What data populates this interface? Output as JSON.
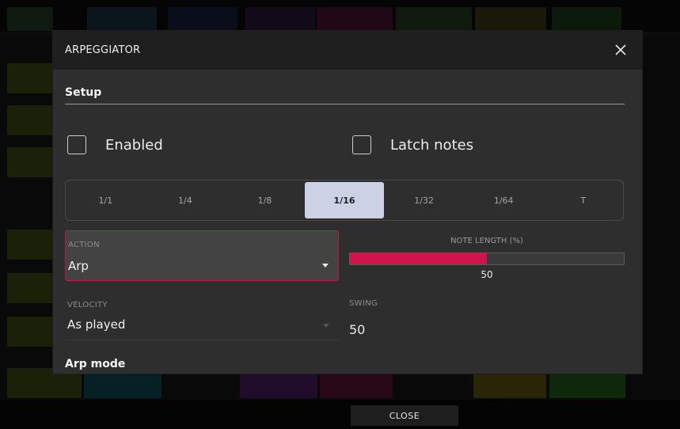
{
  "dialog": {
    "title": "ARPEGGIATOR",
    "setup_title": "Setup",
    "enabled_label": "Enabled",
    "latch_label": "Latch notes",
    "divisions": [
      "1/1",
      "1/4",
      "1/8",
      "1/16",
      "1/32",
      "1/64",
      "T"
    ],
    "active_division": "1/16",
    "action": {
      "label": "ACTION",
      "value": "Arp"
    },
    "note_length": {
      "label": "NOTE LENGTH (%)",
      "value": "50",
      "fraction": 0.5
    },
    "velocity": {
      "label": "VELOCITY",
      "value": "As played"
    },
    "swing": {
      "label": "SWING",
      "value": "50"
    },
    "arp_mode_title": "Arp mode"
  },
  "footer": {
    "close_label": "CLOSE"
  },
  "colors": {
    "accent": "#d3144c",
    "active_division_bg": "#ccd2e3",
    "dialog_bg": "#2e2e2e",
    "header_bg": "#1f1f1f"
  }
}
